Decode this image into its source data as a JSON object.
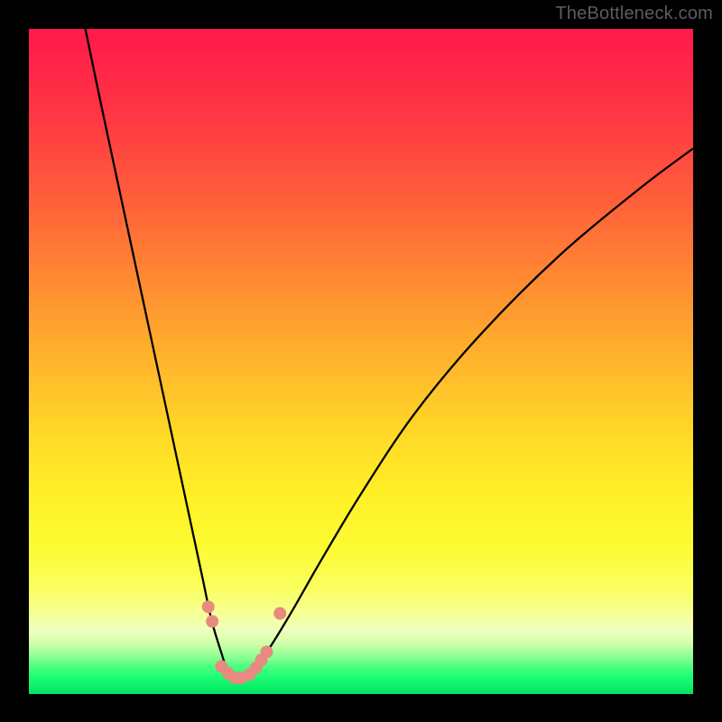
{
  "watermark": {
    "text": "TheBottleneck.com"
  },
  "chart_data": {
    "type": "line",
    "title": "",
    "xlabel": "",
    "ylabel": "",
    "xlim": [
      0,
      100
    ],
    "ylim": [
      0,
      100
    ],
    "grid": false,
    "legend_position": "none",
    "gradient_stops": [
      {
        "offset": 0.0,
        "color": "#ff1a4b"
      },
      {
        "offset": 0.12,
        "color": "#ff3444"
      },
      {
        "offset": 0.24,
        "color": "#ff5a3b"
      },
      {
        "offset": 0.36,
        "color": "#ff8433"
      },
      {
        "offset": 0.48,
        "color": "#ffae2d"
      },
      {
        "offset": 0.6,
        "color": "#ffd627"
      },
      {
        "offset": 0.7,
        "color": "#fff026"
      },
      {
        "offset": 0.78,
        "color": "#fdfb33"
      },
      {
        "offset": 0.84,
        "color": "#faff5e"
      },
      {
        "offset": 0.88,
        "color": "#f6ff94"
      },
      {
        "offset": 0.905,
        "color": "#efffbf"
      },
      {
        "offset": 0.925,
        "color": "#d1ffaa"
      },
      {
        "offset": 0.945,
        "color": "#8dff94"
      },
      {
        "offset": 0.96,
        "color": "#4cff7e"
      },
      {
        "offset": 0.975,
        "color": "#1dff73"
      },
      {
        "offset": 1.0,
        "color": "#02e562"
      }
    ],
    "series": [
      {
        "name": "bottleneck-curve",
        "x": [
          8.5,
          11,
          14,
          17,
          20,
          23,
          26,
          27.5,
          29,
          30,
          31,
          32,
          33.5,
          35,
          37,
          40,
          44,
          50,
          58,
          68,
          80,
          92,
          100
        ],
        "y": [
          100,
          88,
          74,
          60,
          46,
          32,
          18,
          11,
          6,
          3,
          2,
          2,
          3,
          5,
          8,
          13,
          20,
          30,
          42,
          54,
          66,
          76,
          82
        ]
      }
    ],
    "markers": [
      {
        "x": 27.0,
        "y": 13.0
      },
      {
        "x": 27.6,
        "y": 10.8
      },
      {
        "x": 29.0,
        "y": 4.0
      },
      {
        "x": 30.0,
        "y": 3.0
      },
      {
        "x": 31.0,
        "y": 2.3
      },
      {
        "x": 32.0,
        "y": 2.3
      },
      {
        "x": 33.2,
        "y": 2.8
      },
      {
        "x": 34.2,
        "y": 3.8
      },
      {
        "x": 35.0,
        "y": 5.0
      },
      {
        "x": 35.8,
        "y": 6.2
      },
      {
        "x": 37.8,
        "y": 12.0
      }
    ],
    "marker_color": "#e78a80",
    "marker_radius_px": 7
  }
}
